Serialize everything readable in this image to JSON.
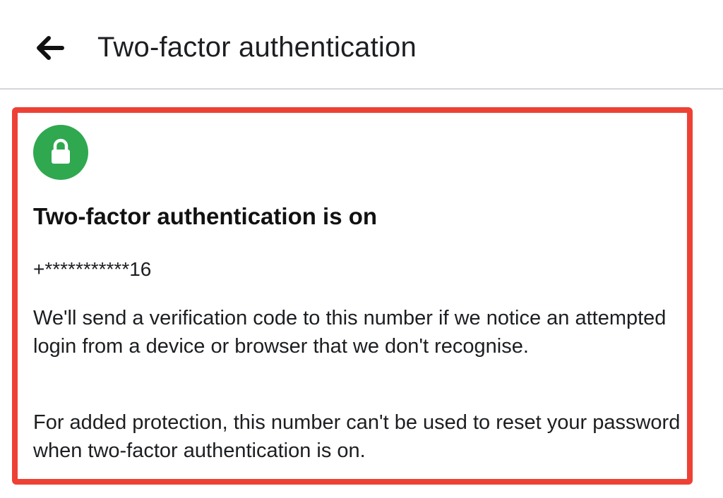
{
  "header": {
    "back_icon": "arrow-left-icon",
    "title": "Two-factor authentication"
  },
  "status_card": {
    "icon": "lock-icon",
    "icon_color": "#2fa84f",
    "highlight_color": "#ee4135",
    "title": "Two-factor authentication is on",
    "phone_masked": "+***********16",
    "description_1": "We'll send a verification code to this number if we notice an attempted login from a device or browser that we don't recognise.",
    "description_2": "For added protection, this number can't be used to reset your password when two-factor authentication is on."
  }
}
